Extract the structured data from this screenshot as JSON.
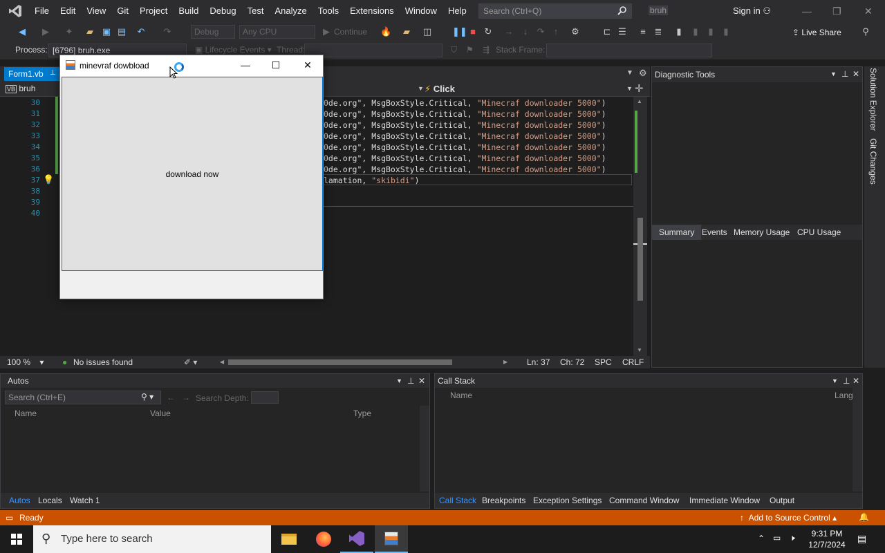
{
  "menubar": {
    "items": [
      "File",
      "Edit",
      "View",
      "Git",
      "Project",
      "Build",
      "Debug",
      "Test",
      "Analyze",
      "Tools",
      "Extensions",
      "Window",
      "Help"
    ],
    "search_placeholder": "Search (Ctrl+Q)",
    "solution_name": "bruh",
    "sign_in": "Sign in"
  },
  "toolbar": {
    "config": "Debug",
    "platform": "Any CPU",
    "continue": "Continue",
    "live_share": "Live Share"
  },
  "toolbar2": {
    "process_label": "Process:",
    "process_value": "[6796] bruh.exe",
    "lifecycle": "Lifecycle Events",
    "thread": "Thread:",
    "stack_frame": "Stack Frame:"
  },
  "doc_tab": {
    "label": "Form1.vb"
  },
  "nav": {
    "left": "bruh",
    "right": "Click"
  },
  "editor": {
    "line_numbers": [
      "30",
      "31",
      "32",
      "33",
      "34",
      "35",
      "36",
      "37",
      "38",
      "39",
      "40"
    ],
    "lines": [
      {
        "pre": "0de.org\", MsgBoxStyle.Critical, ",
        "str": "\"Minecraf downloader 5000\"",
        "post": ")"
      },
      {
        "pre": "0de.org\", MsgBoxStyle.Critical, ",
        "str": "\"Minecraf downloader 5000\"",
        "post": ")"
      },
      {
        "pre": "0de.org\", MsgBoxStyle.Critical, ",
        "str": "\"Minecraf downloader 5000\"",
        "post": ")"
      },
      {
        "pre": "0de.org\", MsgBoxStyle.Critical, ",
        "str": "\"Minecraf downloader 5000\"",
        "post": ")"
      },
      {
        "pre": "0de.org\", MsgBoxStyle.Critical, ",
        "str": "\"Minecraf downloader 5000\"",
        "post": ")"
      },
      {
        "pre": "0de.org\", MsgBoxStyle.Critical, ",
        "str": "\"Minecraf downloader 5000\"",
        "post": ")"
      },
      {
        "pre": "0de.org\", MsgBoxStyle.Critical, ",
        "str": "\"Minecraf downloader 5000\"",
        "post": ")"
      },
      {
        "pre": "lamation, ",
        "str": "\"skibidi\"",
        "post": ")"
      }
    ]
  },
  "editor_status": {
    "zoom": "100 %",
    "issues": "No issues found",
    "ln": "Ln: 37",
    "ch": "Ch: 72",
    "spc": "SPC",
    "crlf": "CRLF"
  },
  "diagnostic": {
    "title": "Diagnostic Tools",
    "tabs": [
      "Summary",
      "Events",
      "Memory Usage",
      "CPU Usage"
    ]
  },
  "right_sidebar": {
    "solution_explorer": "Solution Explorer",
    "git_changes": "Git Changes"
  },
  "autos": {
    "title": "Autos",
    "search_placeholder": "Search (Ctrl+E)",
    "search_depth": "Search Depth:",
    "columns": [
      "Name",
      "Value",
      "Type"
    ],
    "tabs": [
      "Autos",
      "Locals",
      "Watch 1"
    ]
  },
  "callstack": {
    "title": "Call Stack",
    "columns": [
      "Name",
      "Lang"
    ],
    "tabs": [
      "Call Stack",
      "Breakpoints",
      "Exception Settings",
      "Command Window",
      "Immediate Window",
      "Output"
    ]
  },
  "statusbar": {
    "ready": "Ready",
    "add_source": "Add to Source Control"
  },
  "taskbar": {
    "search_placeholder": "Type here to search",
    "time": "9:31 PM",
    "date": "12/7/2024"
  },
  "winform": {
    "title": "minevraf dowbload",
    "button": "download now"
  },
  "colors": {
    "accent": "#007acc",
    "status": "#ca5100",
    "string": "#d69d85",
    "line_number": "#2b91af"
  }
}
